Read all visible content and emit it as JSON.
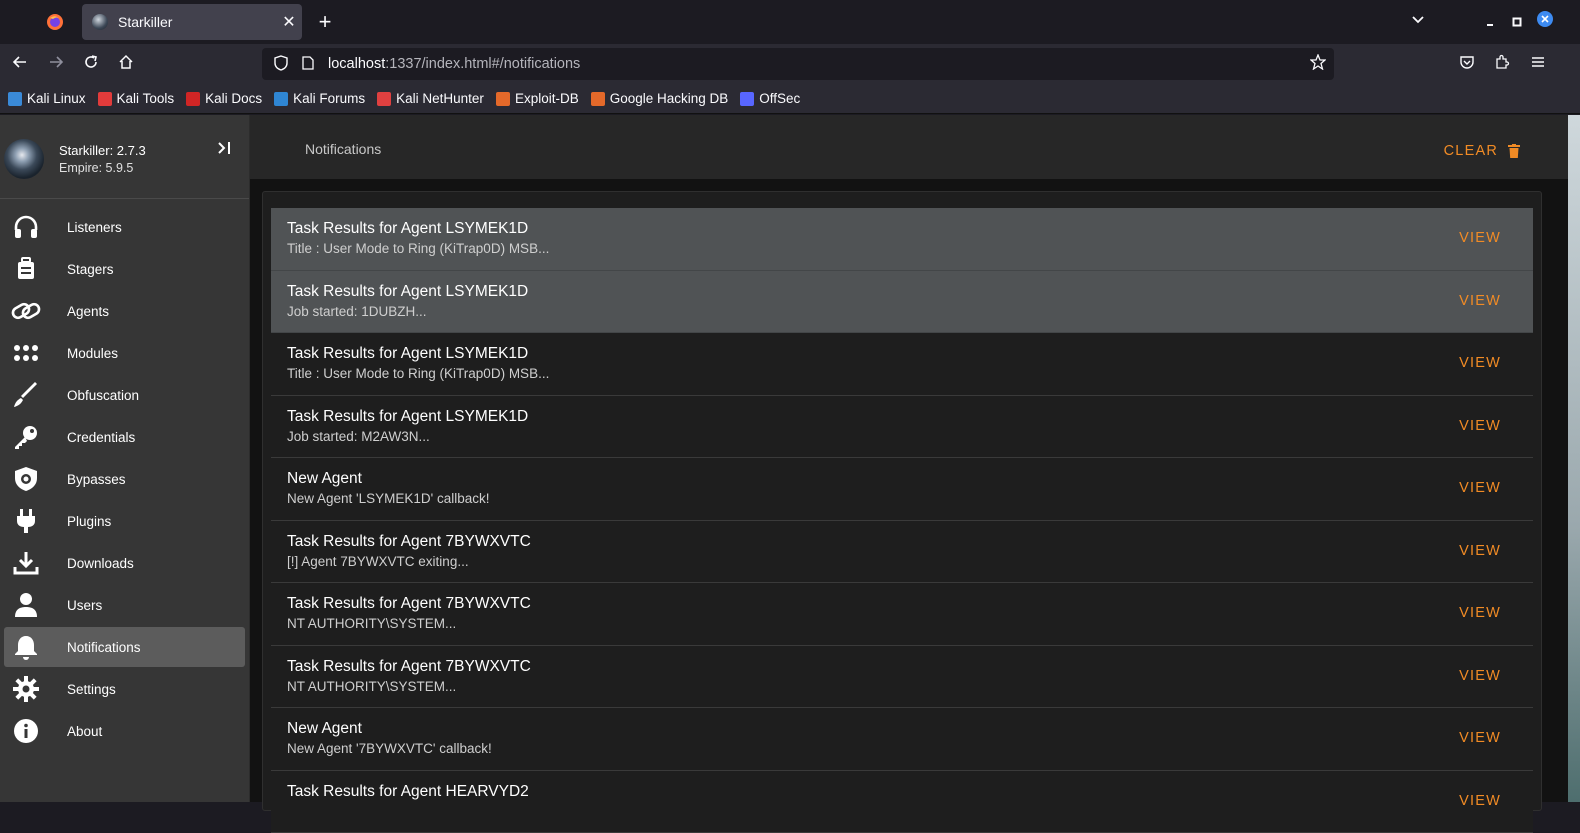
{
  "browser": {
    "tab_title": "Starkiller",
    "url_host": "localhost",
    "url_path": ":1337/index.html#/notifications",
    "bookmarks": [
      {
        "label": "Kali Linux",
        "color": "#3a8ad8"
      },
      {
        "label": "Kali Tools",
        "color": "#e23b3b"
      },
      {
        "label": "Kali Docs",
        "color": "#d02525"
      },
      {
        "label": "Kali Forums",
        "color": "#2f86d4"
      },
      {
        "label": "Kali NetHunter",
        "color": "#e04040"
      },
      {
        "label": "Exploit-DB",
        "color": "#e4692a"
      },
      {
        "label": "Google Hacking DB",
        "color": "#e4692a"
      },
      {
        "label": "OffSec",
        "color": "#5866ff"
      }
    ]
  },
  "sidebar": {
    "version_starkiller": "Starkiller: 2.7.3",
    "version_empire": "Empire: 5.9.5",
    "items": [
      {
        "label": "Listeners",
        "icon": "headphones-icon"
      },
      {
        "label": "Stagers",
        "icon": "luggage-icon"
      },
      {
        "label": "Agents",
        "icon": "link-icon"
      },
      {
        "label": "Modules",
        "icon": "grid-dots-icon"
      },
      {
        "label": "Obfuscation",
        "icon": "brush-icon"
      },
      {
        "label": "Credentials",
        "icon": "key-icon"
      },
      {
        "label": "Bypasses",
        "icon": "shield-gear-icon"
      },
      {
        "label": "Plugins",
        "icon": "plug-icon"
      },
      {
        "label": "Downloads",
        "icon": "download-icon"
      },
      {
        "label": "Users",
        "icon": "user-icon"
      },
      {
        "label": "Notifications",
        "icon": "bell-icon",
        "active": true
      },
      {
        "label": "Settings",
        "icon": "gear-icon"
      },
      {
        "label": "About",
        "icon": "info-icon"
      }
    ]
  },
  "main": {
    "title": "Notifications",
    "clear_label": "CLEAR",
    "view_label": "VIEW",
    "accent_color": "#f18b25",
    "notifications": [
      {
        "title": "Task Results for Agent LSYMEK1D",
        "subtitle": "Title : User Mode to Ring (KiTrap0D) MSB...",
        "highlight": true
      },
      {
        "title": "Task Results for Agent LSYMEK1D",
        "subtitle": "Job started: 1DUBZH...",
        "highlight": true
      },
      {
        "title": "Task Results for Agent LSYMEK1D",
        "subtitle": "Title : User Mode to Ring (KiTrap0D) MSB...",
        "highlight": false
      },
      {
        "title": "Task Results for Agent LSYMEK1D",
        "subtitle": "Job started: M2AW3N...",
        "highlight": false
      },
      {
        "title": "New Agent",
        "subtitle": "New Agent 'LSYMEK1D' callback!",
        "highlight": false
      },
      {
        "title": "Task Results for Agent 7BYWXVTC",
        "subtitle": "[!] Agent 7BYWXVTC exiting...",
        "highlight": false
      },
      {
        "title": "Task Results for Agent 7BYWXVTC",
        "subtitle": "NT AUTHORITY\\SYSTEM...",
        "highlight": false
      },
      {
        "title": "Task Results for Agent 7BYWXVTC",
        "subtitle": "NT AUTHORITY\\SYSTEM...",
        "highlight": false
      },
      {
        "title": "New Agent",
        "subtitle": "New Agent '7BYWXVTC' callback!",
        "highlight": false
      },
      {
        "title": "Task Results for Agent HEARVYD2",
        "subtitle": "",
        "highlight": false
      }
    ]
  }
}
